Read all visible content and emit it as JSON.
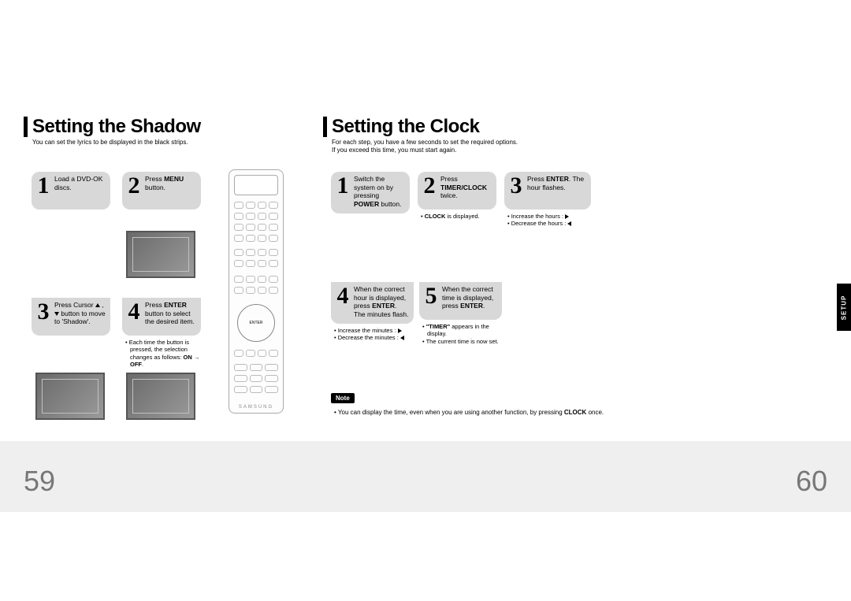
{
  "left": {
    "title": "Setting the Shadow",
    "subtitle": "You can set the lyrics to be displayed in the black strips.",
    "page_num": "59",
    "steps": {
      "s1": {
        "num": "1",
        "text": "Load a DVD-OK discs."
      },
      "s2": {
        "num": "2",
        "text_pre": "Press ",
        "bold": "MENU",
        "text_post": " button."
      },
      "s3": {
        "num": "3",
        "text_pre": "Press Cursor ",
        "text_post": " button to move to 'Shadow'."
      },
      "s4": {
        "num": "4",
        "text_pre": "Press ",
        "bold": "ENTER",
        "text_post": " button to select the desired item.",
        "sub": [
          "Each time the button is pressed, the selection changes as follows: ON → OFF."
        ]
      }
    }
  },
  "right": {
    "title": "Setting the Clock",
    "subtitle_line1": "For each step, you have a few seconds to set the required options.",
    "subtitle_line2": "If you exceed this time, you must start again.",
    "page_num": "60",
    "tab": "SETUP",
    "steps": {
      "s1": {
        "num": "1",
        "text_pre": "Switch the system on by pressing ",
        "bold": "POWER",
        "text_post": " button."
      },
      "s2": {
        "num": "2",
        "text_pre": "Press ",
        "bold": "TIMER/CLOCK",
        "text_post": " twice.",
        "sub_bold": "CLOCK",
        "sub_rest": " is displayed."
      },
      "s3": {
        "num": "3",
        "text_pre": "Press ",
        "bold": "ENTER",
        "text_post": ". The hour flashes.",
        "sub_inc": "Increase the hours : ",
        "sub_dec": "Decrease the hours : "
      },
      "s4": {
        "num": "4",
        "text_pre": "When the correct hour is displayed, press ",
        "bold": "ENTER",
        "text_post": ". The minutes flash.",
        "sub_inc": "Increase the minutes : ",
        "sub_dec": "Decrease the minutes : "
      },
      "s5": {
        "num": "5",
        "text_pre": "When the correct time is displayed, press ",
        "bold": "ENTER",
        "text_post": ".",
        "sub_a_quote": "\"TIMER\"",
        "sub_a_rest": " appears in the display.",
        "sub_b": "The current time is now set."
      }
    },
    "note_label": "Note",
    "note_text_pre": "You can display the time, even when you are using another function, by pressing ",
    "note_bold": "CLOCK",
    "note_text_post": " once."
  },
  "remote_brand": "SAMSUNG"
}
